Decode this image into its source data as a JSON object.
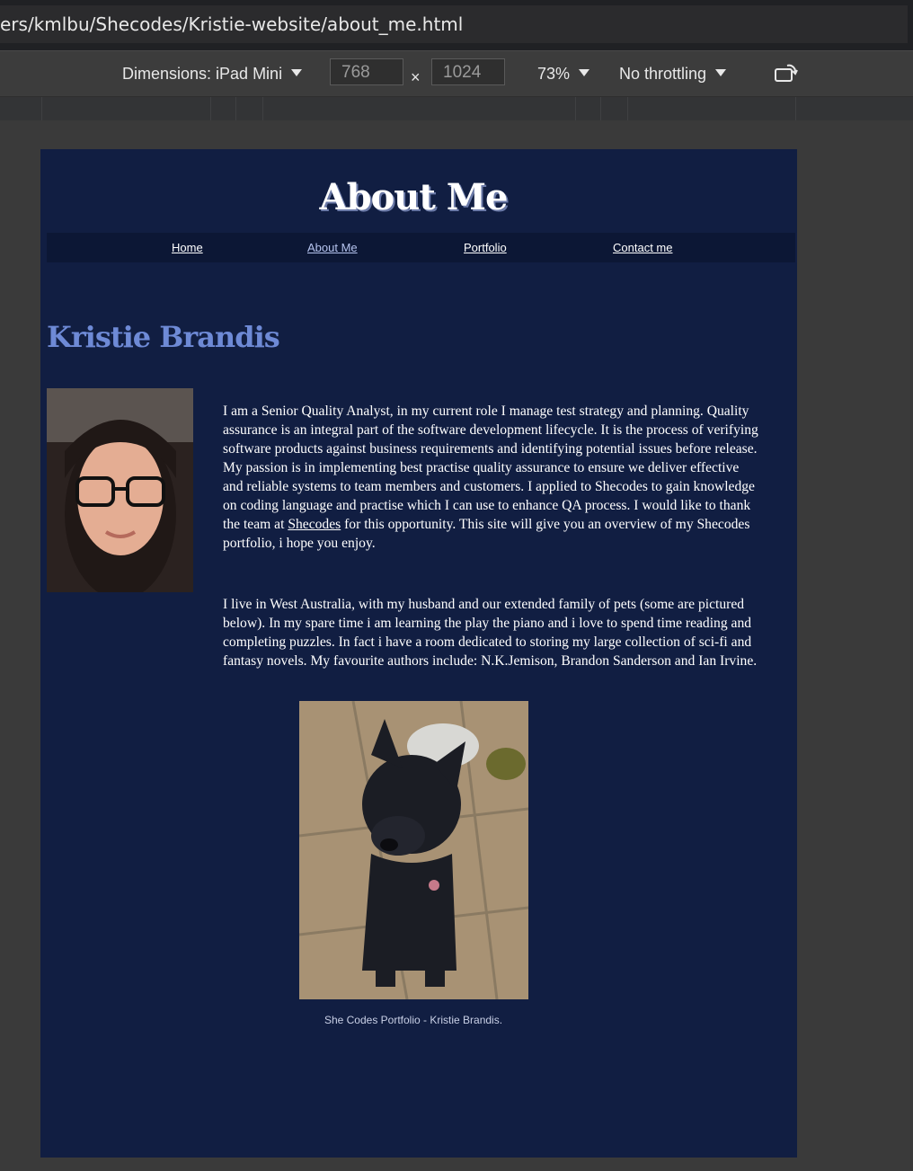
{
  "browser": {
    "url": "ers/kmlbu/Shecodes/Kristie-website/about_me.html"
  },
  "devtools": {
    "dimensions_label": "Dimensions: iPad Mini",
    "width_value": "768",
    "times": "×",
    "height_value": "1024",
    "zoom": "73%",
    "throttling": "No throttling",
    "rotate_icon": "rotate-icon"
  },
  "page": {
    "title": "About Me",
    "nav": {
      "home": "Home",
      "about": "About Me",
      "portfolio": "Portfolio",
      "contact": "Contact me"
    },
    "name": "Kristie Brandis",
    "para1_before_link": "I am a Senior Quality Analyst, in my current role I manage test strategy and planning. Quality assurance is an integral part of the software development lifecycle. It is the process of verifying software products against business requirements and identifying potential issues before release. My passion is in implementing best practise quality assurance to ensure we deliver effective and reliable systems to team members and customers. I applied to Shecodes to gain knowledge on coding language and practise which I can use to enhance QA process. I would like to thank the team at ",
    "para1_link": "Shecodes",
    "para1_after_link": " for this opportunity. This site will give you an overview of my Shecodes portfolio, i hope you enjoy.",
    "para2": "I live in West Australia, with my husband and our extended family of pets (some are pictured below). In my spare time i am learning the play the piano and i love to spend time reading and completing puzzles. In fact i have a room dedicated to storing my large collection of sci-fi and fantasy novels. My favourite authors include: N.K.Jemison, Brandon Sanderson and Ian Irvine.",
    "footer": "She Codes Portfolio - Kristie Brandis."
  }
}
